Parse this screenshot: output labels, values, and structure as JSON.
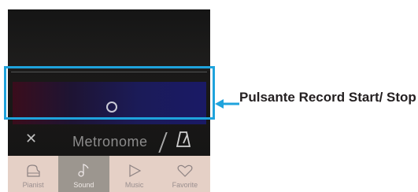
{
  "metronome": {
    "label": "Metronome"
  },
  "tabs": [
    {
      "label": "Pianist",
      "icon": "piano-icon",
      "active": false
    },
    {
      "label": "Sound",
      "icon": "music-note-icon",
      "active": true
    },
    {
      "label": "Music",
      "icon": "play-icon",
      "active": false
    },
    {
      "label": "Favorite",
      "icon": "heart-icon",
      "active": false
    }
  ],
  "callout": {
    "text": "Pulsante Record Start/ Stop"
  },
  "colors": {
    "highlight": "#1fa3dc",
    "tabbar": "#e5d0c6",
    "active_tab": "#9c968f"
  }
}
